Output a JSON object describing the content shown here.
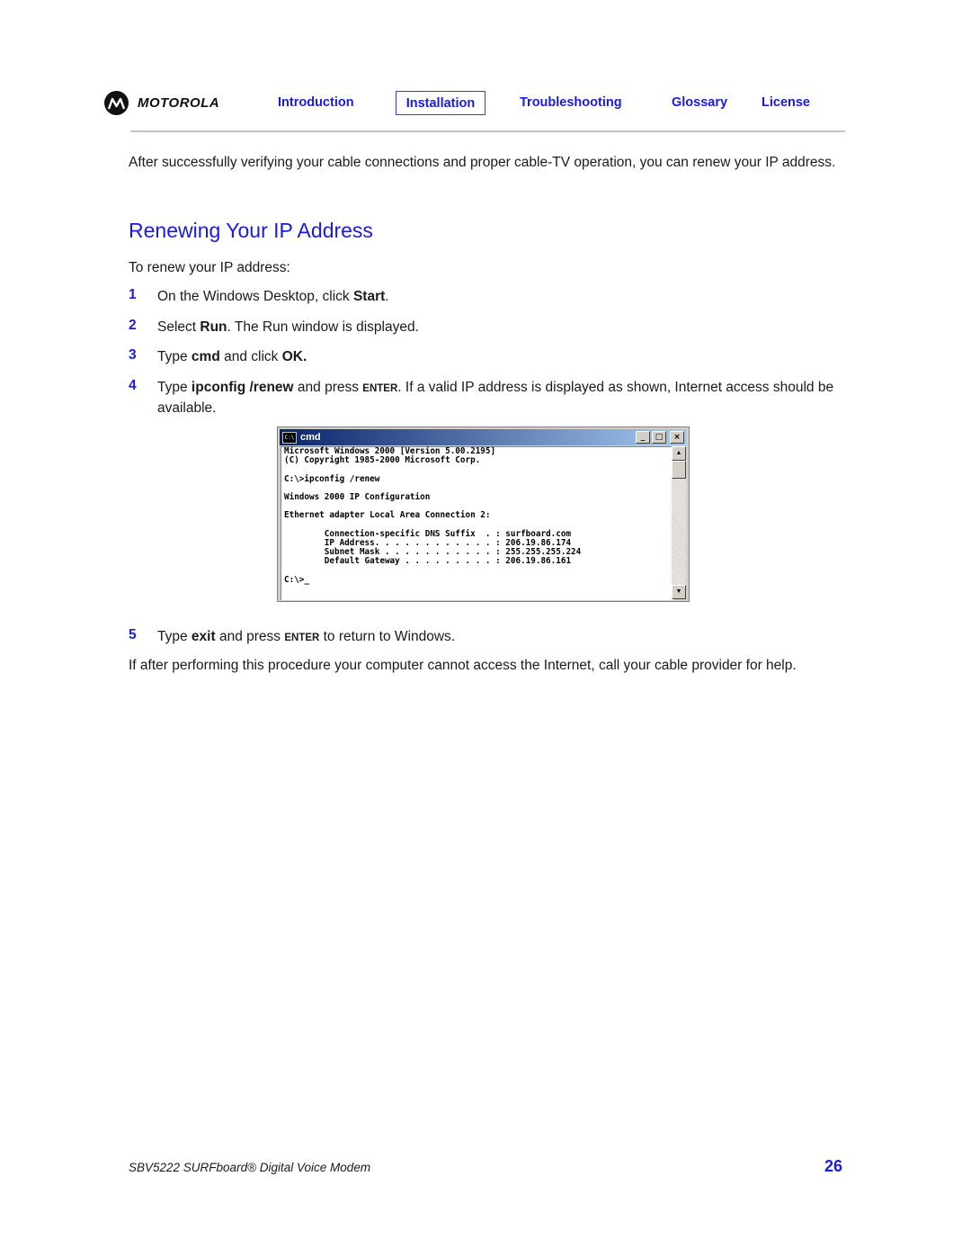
{
  "header": {
    "brand": "MOTOROLA",
    "nav": [
      {
        "label": "Introduction",
        "active": false
      },
      {
        "label": "Installation",
        "active": true
      },
      {
        "label": "Troubleshooting",
        "active": false
      },
      {
        "label": "Glossary",
        "active": false
      },
      {
        "label": "License",
        "active": false
      }
    ]
  },
  "intro": "After successfully verifying your cable connections and proper cable-TV operation, you can renew your IP address.",
  "section": {
    "title": "Renewing Your IP Address",
    "lead": "To renew your IP address:",
    "steps": [
      {
        "num": "1",
        "parts": [
          "On the Windows Desktop, click ",
          "Start",
          "."
        ]
      },
      {
        "num": "2",
        "parts": [
          "Select ",
          "Run",
          ". The Run window is displayed."
        ]
      },
      {
        "num": "3",
        "parts": [
          "Type ",
          "cmd",
          " and click ",
          "OK."
        ]
      },
      {
        "num": "4",
        "parts": [
          "Type ",
          "ipconfig /renew",
          " and press ",
          "ENTER",
          ". If a valid IP address is displayed as shown, Internet access should be available."
        ]
      },
      {
        "num": "5",
        "parts": [
          "Type ",
          "exit",
          " and press ",
          "ENTER",
          " to return to Windows."
        ]
      }
    ],
    "closing": "If after performing this procedure your computer cannot access the Internet, call your cable provider for help."
  },
  "cmd_window": {
    "title": "cmd",
    "icon_text": "C:\\",
    "buttons": {
      "minimize": "_",
      "maximize": "□",
      "close": "×"
    },
    "lines": [
      "Microsoft Windows 2000 [Version 5.00.2195]",
      "(C) Copyright 1985-2000 Microsoft Corp.",
      "",
      "C:\\>ipconfig /renew",
      "",
      "Windows 2000 IP Configuration",
      "",
      "Ethernet adapter Local Area Connection 2:",
      "",
      "        Connection-specific DNS Suffix  . : surfboard.com",
      "        IP Address. . . . . . . . . . . . : 206.19.86.174",
      "        Subnet Mask . . . . . . . . . . . : 255.255.255.224",
      "        Default Gateway . . . . . . . . . : 206.19.86.161",
      "",
      "C:\\>_"
    ]
  },
  "footer": {
    "title": "SBV5222 SURFboard® Digital Voice Modem",
    "page": "26"
  },
  "colors": {
    "accent": "#1a1ae6",
    "rule": "#c4c4c4"
  }
}
